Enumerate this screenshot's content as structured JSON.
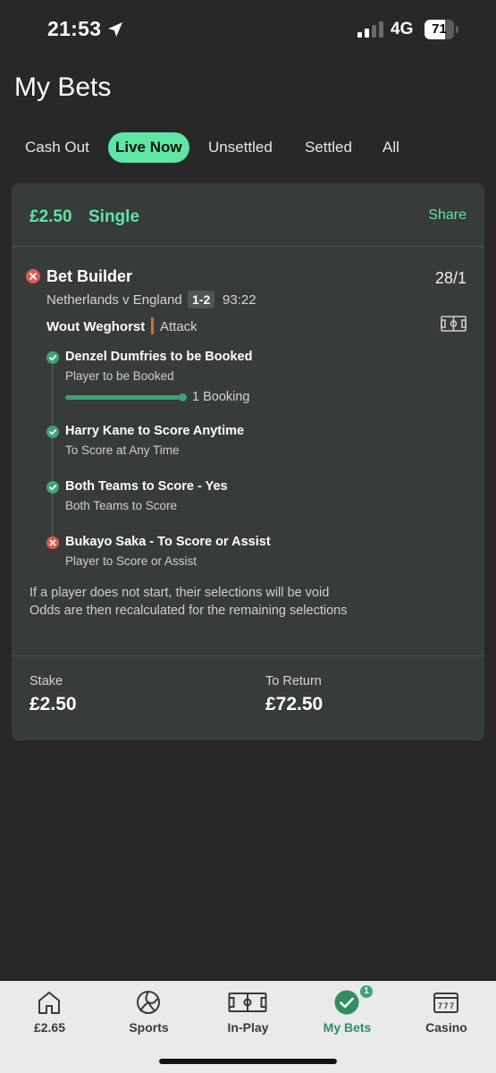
{
  "status_bar": {
    "time": "21:53",
    "network": "4G",
    "battery": "71",
    "battery_level": 0.71
  },
  "page": {
    "title": "My Bets"
  },
  "tabs": [
    {
      "label": "Cash Out",
      "active": false
    },
    {
      "label": "Live Now",
      "active": true
    },
    {
      "label": "Unsettled",
      "active": false
    },
    {
      "label": "Settled",
      "active": false
    },
    {
      "label": "All",
      "active": false
    }
  ],
  "bet": {
    "amount": "£2.50",
    "type": "Single",
    "share_label": "Share",
    "title": "Bet Builder",
    "odds": "28/1",
    "match": "Netherlands v England",
    "score": "1-2",
    "clock": "93:22",
    "player": "Wout Weghorst",
    "position": "Attack",
    "selections": [
      {
        "title": "Denzel Dumfries to be Booked",
        "subtitle": "Player to be Booked",
        "status": "won",
        "progress_label": "1 Booking",
        "progress": 1.0
      },
      {
        "title": "Harry Kane to Score Anytime",
        "subtitle": "To Score at Any Time",
        "status": "won"
      },
      {
        "title": "Both Teams to Score - Yes",
        "subtitle": "Both Teams to Score",
        "status": "won"
      },
      {
        "title": "Bukayo Saka - To Score or Assist",
        "subtitle": "Player to Score or Assist",
        "status": "lost"
      }
    ],
    "notes": [
      "If a player does not start, their selections will be void",
      "Odds are then recalculated for the remaining selections"
    ],
    "stake_label": "Stake",
    "stake_value": "£2.50",
    "return_label": "To Return",
    "return_value": "£72.50"
  },
  "colors": {
    "accent": "#5ee6a5",
    "won": "#3fa374",
    "lost": "#e05a4f",
    "background": "#282828",
    "card": "#373b39"
  },
  "bottom_nav": [
    {
      "label": "£2.65",
      "icon": "home-icon",
      "active": false
    },
    {
      "label": "Sports",
      "icon": "football-icon",
      "active": false
    },
    {
      "label": "In-Play",
      "icon": "pitch-icon",
      "active": false
    },
    {
      "label": "My Bets",
      "icon": "check-circle-icon",
      "active": true,
      "badge": "1"
    },
    {
      "label": "Casino",
      "icon": "slot-machine-icon",
      "active": false
    }
  ]
}
